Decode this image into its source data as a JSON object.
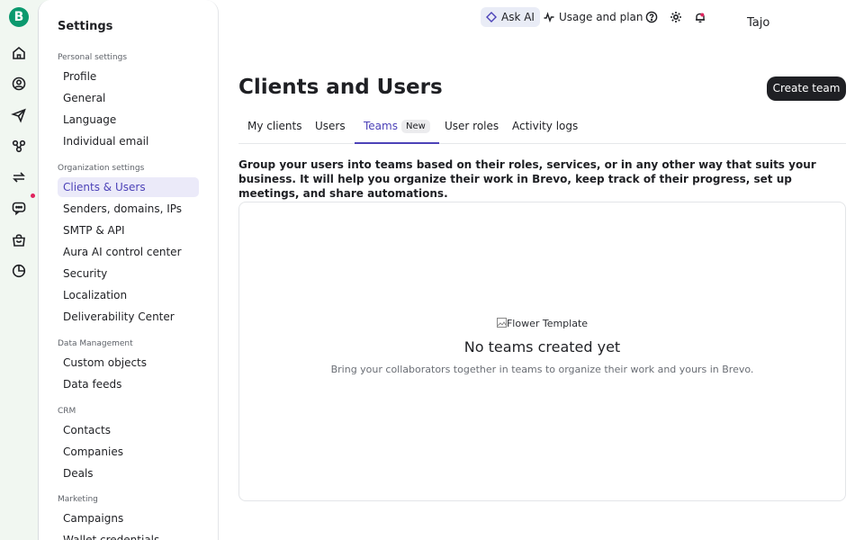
{
  "brand": {
    "logo_letter": "B",
    "color": "#0b996e"
  },
  "rail": {
    "icons": [
      "home-icon",
      "contacts-icon",
      "campaigns-send-icon",
      "automations-icon",
      "transactional-icon",
      "conversations-icon",
      "sales-icon",
      "reports-icon"
    ],
    "notification_dot_color": "#e0245e"
  },
  "settings_nav": {
    "title": "Settings",
    "groups": [
      {
        "label": "Personal settings",
        "items": [
          "Profile",
          "General",
          "Language",
          "Individual email"
        ]
      },
      {
        "label": "Organization settings",
        "items": [
          "Clients & Users",
          "Senders, domains, IPs",
          "SMTP & API",
          "Aura AI control center",
          "Security",
          "Localization",
          "Deliverability Center"
        ]
      },
      {
        "label": "Data Management",
        "items": [
          "Custom objects",
          "Data feeds"
        ]
      },
      {
        "label": "CRM",
        "items": [
          "Contacts",
          "Companies",
          "Deals"
        ]
      },
      {
        "label": "Marketing",
        "items": [
          "Campaigns",
          "Wallet credentials"
        ]
      }
    ],
    "active_item": "Clients & Users",
    "accent": "#4c42b8"
  },
  "topbar": {
    "ask_ai": "Ask AI",
    "usage": "Usage and plan",
    "icons": [
      "help-icon",
      "settings-gear-icon",
      "notifications-bell-icon"
    ],
    "user_name": "Tajo"
  },
  "main": {
    "title": "Clients and Users",
    "create_button": "Create team",
    "tabs": [
      {
        "label": "My clients"
      },
      {
        "label": "Users"
      },
      {
        "label": "Teams",
        "badge": "New",
        "active": true
      },
      {
        "label": "User roles"
      },
      {
        "label": "Activity logs"
      }
    ],
    "intro": "Group your users into teams based on their roles, services, or in any other way that suits your business. It will help you organize their work in Brevo, keep track of their progress, set up meetings, and share automations.",
    "empty_state": {
      "image_alt": "Flower Template",
      "title": "No teams created yet",
      "subtitle": "Bring your collaborators together in teams to organize their work and yours in Brevo."
    }
  }
}
